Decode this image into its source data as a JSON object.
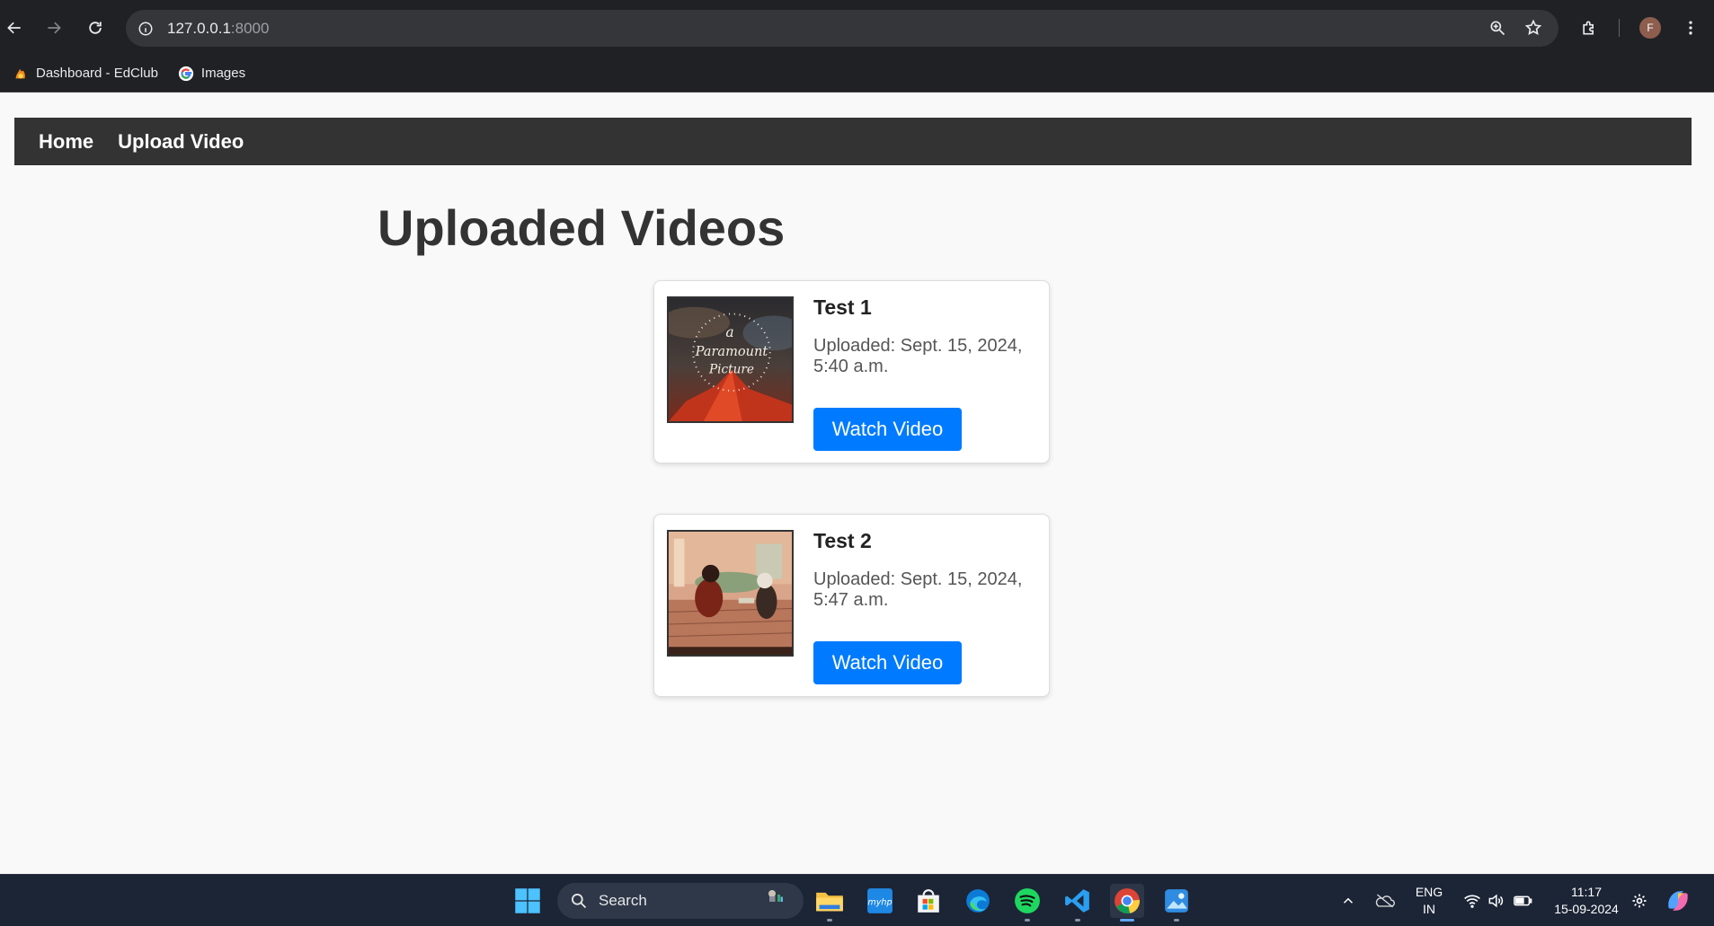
{
  "browser": {
    "url_host": "127.0.0.1",
    "url_port": ":8000",
    "avatar_letter": "F",
    "bookmarks": [
      {
        "label": "Dashboard - EdClub",
        "icon": "edclub-icon"
      },
      {
        "label": "Images",
        "icon": "google-icon"
      }
    ]
  },
  "nav": {
    "home": "Home",
    "upload": "Upload Video"
  },
  "page": {
    "title": "Uploaded Videos"
  },
  "videos": [
    {
      "title": "Test 1",
      "uploaded": "Uploaded: Sept. 15, 2024, 5:40 a.m.",
      "button": "Watch Video",
      "thumb_text": [
        "a",
        "Paramount",
        "Picture"
      ]
    },
    {
      "title": "Test 2",
      "uploaded": "Uploaded: Sept. 15, 2024, 5:47 a.m.",
      "button": "Watch Video"
    }
  ],
  "taskbar": {
    "search_label": "Search",
    "lang_top": "ENG",
    "lang_bottom": "IN",
    "time": "11:17",
    "date": "15-09-2024"
  },
  "colors": {
    "accent": "#007bff",
    "navbar": "#333333",
    "taskbar": "#1c2536"
  }
}
